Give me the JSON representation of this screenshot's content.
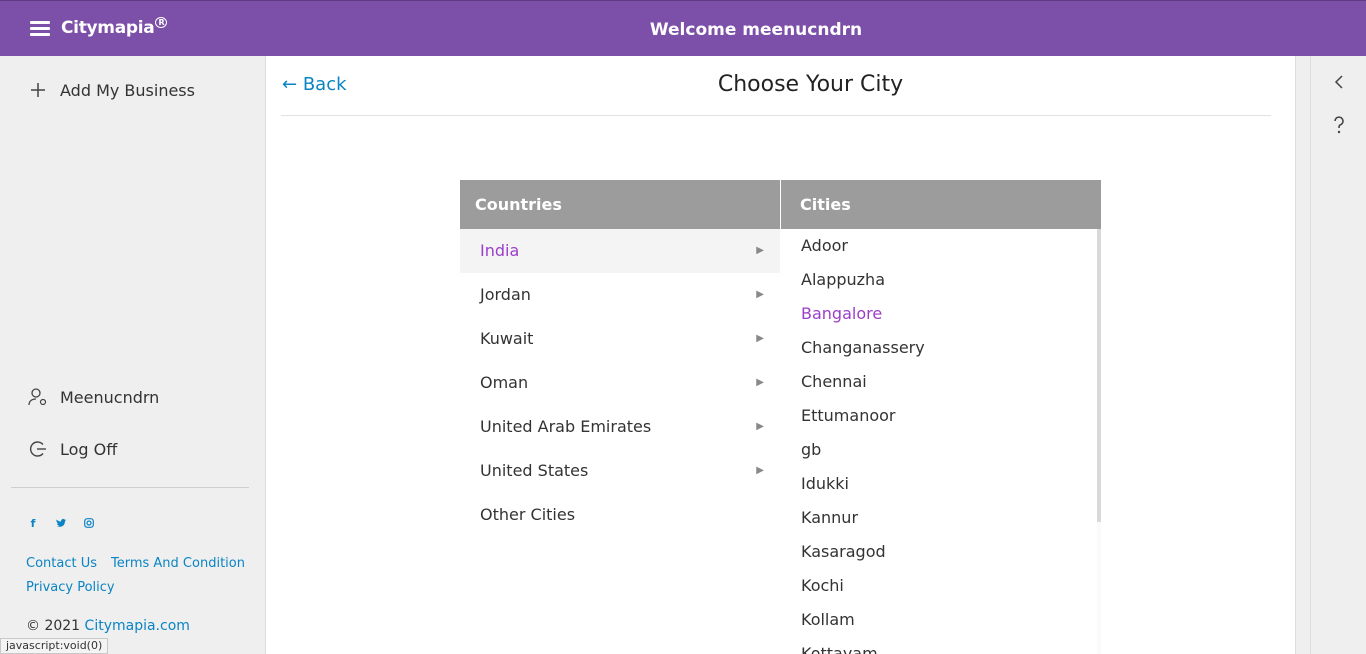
{
  "header": {
    "brand": "Citymapia",
    "brand_mark": "R",
    "welcome": "Welcome meenucndrn"
  },
  "sidebar": {
    "add_business": "Add My Business",
    "user": "Meenucndrn",
    "logoff": "Log Off",
    "socials": [
      "facebook-icon",
      "twitter-icon",
      "instagram-icon"
    ],
    "links": {
      "contact": "Contact Us",
      "terms": "Terms And Condition",
      "privacy": "Privacy Policy"
    },
    "copyright_prefix": "© 2021",
    "copyright_link": "Citymapia.com"
  },
  "status_bar": "javascript:void(0)",
  "main": {
    "back": "Back",
    "title": "Choose Your City",
    "countries_header": "Countries",
    "cities_header": "Cities",
    "countries": [
      {
        "name": "India",
        "active": true,
        "has_children": true
      },
      {
        "name": "Jordan",
        "active": false,
        "has_children": true
      },
      {
        "name": "Kuwait",
        "active": false,
        "has_children": true
      },
      {
        "name": "Oman",
        "active": false,
        "has_children": true
      },
      {
        "name": "United Arab Emirates",
        "active": false,
        "has_children": true
      },
      {
        "name": "United States",
        "active": false,
        "has_children": true
      },
      {
        "name": "Other Cities",
        "active": false,
        "has_children": false
      }
    ],
    "cities": [
      {
        "name": "Adoor",
        "active": false
      },
      {
        "name": "Alappuzha",
        "active": false
      },
      {
        "name": "Bangalore",
        "active": true
      },
      {
        "name": "Changanassery",
        "active": false
      },
      {
        "name": "Chennai",
        "active": false
      },
      {
        "name": "Ettumanoor",
        "active": false
      },
      {
        "name": "gb",
        "active": false
      },
      {
        "name": "Idukki",
        "active": false
      },
      {
        "name": "Kannur",
        "active": false
      },
      {
        "name": "Kasaragod",
        "active": false
      },
      {
        "name": "Kochi",
        "active": false
      },
      {
        "name": "Kollam",
        "active": false
      },
      {
        "name": "Kottayam",
        "active": false
      }
    ]
  },
  "colors": {
    "header_bg": "#7c4fa8",
    "accent_purple": "#9b3ec9",
    "link_blue": "#0a84c4",
    "table_header": "#9c9c9c"
  }
}
